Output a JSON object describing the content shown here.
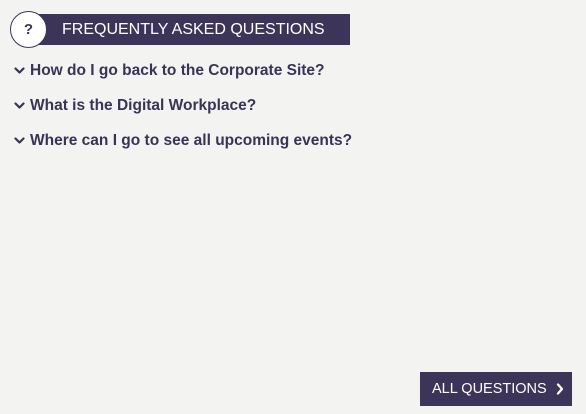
{
  "faq": {
    "header": {
      "title": "FREQUENTLY ASKED QUESTIONS",
      "badge": "?"
    },
    "questions": [
      {
        "text": "How do I go back to the Corporate Site?",
        "icon": "chevron-down-icon"
      },
      {
        "text": "What is the Digital Workplace?",
        "icon": "chevron-down-icon"
      },
      {
        "text": "Where can I go to see all upcoming events?",
        "icon": "chevron-down-icon"
      }
    ],
    "all_questions_button": {
      "label": "ALL QUESTIONS",
      "icon": "chevron-right-icon"
    }
  },
  "colors": {
    "accent": "#3d3559",
    "text": "#3a3356",
    "background": "#f3f3f2"
  }
}
